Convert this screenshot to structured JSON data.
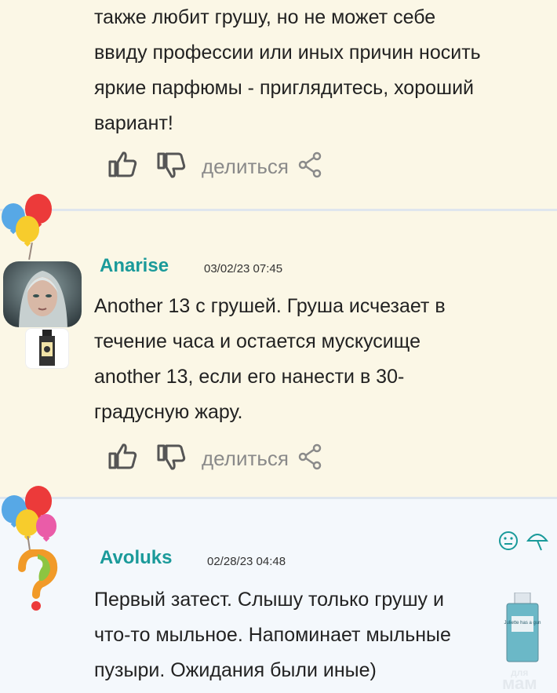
{
  "comments": [
    {
      "text": "также любит грушу, но не может себе\nввиду профессии или иных причин носить\nяркие парфюмы - приглядитесь, хороший\nвариант!",
      "share_label": "делиться"
    },
    {
      "username": "Anarise",
      "date": "03/02/23 07:45",
      "text": "Another 13 с грушей. Груша исчезает в\nтечение часа и остается мускусище\nanother 13, если его нанести в 30-\nградусную жару.",
      "share_label": "делиться"
    },
    {
      "username": "Avoluks",
      "date": "02/28/23 04:48",
      "text": "Первый затест. Слышу только грушу и\nчто-то мыльное. Напоминает мыльные\nпузыри. Ожидания были иные)"
    }
  ],
  "watermark": {
    "small": "для",
    "big": "мам"
  },
  "bottle_label": "Juliette has a gun",
  "icons": {
    "like": "thumbs-up-icon",
    "dislike": "thumbs-down-icon",
    "share": "share-icon",
    "neutral": "neutral-face-icon",
    "umbrella": "umbrella-icon"
  },
  "colors": {
    "username": "#1a9a9a",
    "action_gray": "#8a8a8a"
  }
}
